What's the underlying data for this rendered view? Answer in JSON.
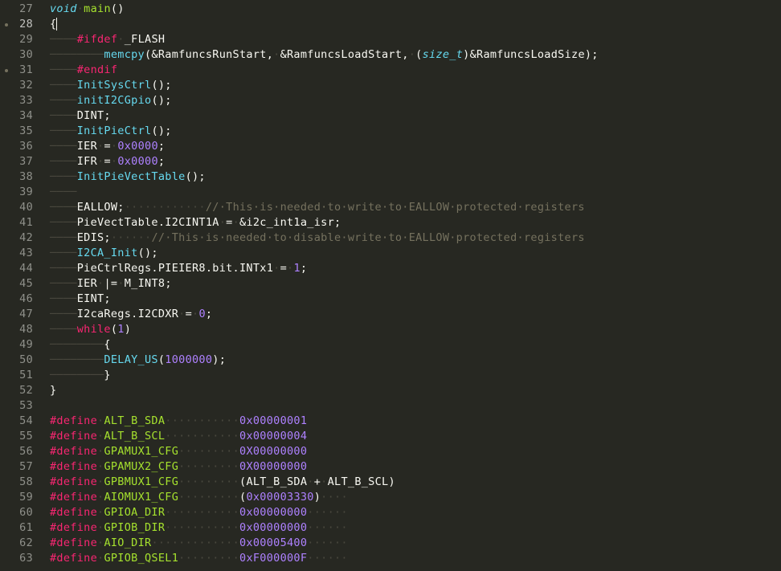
{
  "editor": {
    "theme": "monokai",
    "colors": {
      "background": "#272822",
      "text": "#f8f8f2",
      "keyword": "#f92672",
      "function": "#66d9ef",
      "number": "#ae81ff",
      "comment": "#75715e",
      "line_number": "#8f908a",
      "whitespace_marker": "#49483e"
    },
    "lines": [
      {
        "num": "27",
        "tokens": [
          {
            "t": "void",
            "c": "kwi"
          },
          {
            "t": "·",
            "c": "ws"
          },
          {
            "t": "main",
            "c": "fn"
          },
          {
            "t": "()",
            "c": "text"
          }
        ]
      },
      {
        "num": "28",
        "current": true,
        "marked": true,
        "tokens": [
          {
            "t": "{",
            "c": "text"
          },
          {
            "cursor": true
          }
        ]
      },
      {
        "num": "29",
        "tokens": [
          {
            "t": "────",
            "c": "guide"
          },
          {
            "t": "#ifdef",
            "c": "pre"
          },
          {
            "t": "·",
            "c": "ws"
          },
          {
            "t": "_FLASH",
            "c": "text"
          }
        ]
      },
      {
        "num": "30",
        "tokens": [
          {
            "t": "────────",
            "c": "guide"
          },
          {
            "t": "memcpy",
            "c": "fnb"
          },
          {
            "t": "(&RamfuncsRunStart,",
            "c": "text"
          },
          {
            "t": "·",
            "c": "ws"
          },
          {
            "t": "&RamfuncsLoadStart,",
            "c": "text"
          },
          {
            "t": "·",
            "c": "ws"
          },
          {
            "t": "(",
            "c": "text"
          },
          {
            "t": "size_t",
            "c": "typei"
          },
          {
            "t": ")&RamfuncsLoadSize);",
            "c": "text"
          }
        ]
      },
      {
        "num": "31",
        "marked": true,
        "tokens": [
          {
            "t": "────",
            "c": "guide"
          },
          {
            "t": "#endif",
            "c": "pre"
          }
        ]
      },
      {
        "num": "32",
        "tokens": [
          {
            "t": "────",
            "c": "guide"
          },
          {
            "t": "InitSysCtrl",
            "c": "fnb"
          },
          {
            "t": "();",
            "c": "text"
          }
        ]
      },
      {
        "num": "33",
        "tokens": [
          {
            "t": "────",
            "c": "guide"
          },
          {
            "t": "initI2CGpio",
            "c": "fnb"
          },
          {
            "t": "();",
            "c": "text"
          }
        ]
      },
      {
        "num": "34",
        "tokens": [
          {
            "t": "────",
            "c": "guide"
          },
          {
            "t": "DINT;",
            "c": "text"
          }
        ]
      },
      {
        "num": "35",
        "tokens": [
          {
            "t": "────",
            "c": "guide"
          },
          {
            "t": "InitPieCtrl",
            "c": "fnb"
          },
          {
            "t": "();",
            "c": "text"
          }
        ]
      },
      {
        "num": "36",
        "tokens": [
          {
            "t": "────",
            "c": "guide"
          },
          {
            "t": "IER",
            "c": "text"
          },
          {
            "t": "·",
            "c": "ws"
          },
          {
            "t": "=",
            "c": "text"
          },
          {
            "t": "·",
            "c": "ws"
          },
          {
            "t": "0x0000",
            "c": "num"
          },
          {
            "t": ";",
            "c": "text"
          }
        ]
      },
      {
        "num": "37",
        "tokens": [
          {
            "t": "────",
            "c": "guide"
          },
          {
            "t": "IFR",
            "c": "text"
          },
          {
            "t": "·",
            "c": "ws"
          },
          {
            "t": "=",
            "c": "text"
          },
          {
            "t": "·",
            "c": "ws"
          },
          {
            "t": "0x0000",
            "c": "num"
          },
          {
            "t": ";",
            "c": "text"
          }
        ]
      },
      {
        "num": "38",
        "tokens": [
          {
            "t": "────",
            "c": "guide"
          },
          {
            "t": "InitPieVectTable",
            "c": "fnb"
          },
          {
            "t": "();",
            "c": "text"
          }
        ]
      },
      {
        "num": "39",
        "tokens": [
          {
            "t": "────",
            "c": "guide"
          }
        ]
      },
      {
        "num": "40",
        "tokens": [
          {
            "t": "────",
            "c": "guide"
          },
          {
            "t": "EALLOW;",
            "c": "text"
          },
          {
            "t": "············",
            "c": "ws"
          },
          {
            "t": "//·This·is·needed·to·write·to·EALLOW·protected·registers",
            "c": "cmt"
          }
        ]
      },
      {
        "num": "41",
        "tokens": [
          {
            "t": "────",
            "c": "guide"
          },
          {
            "t": "PieVectTable.I2CINT1A",
            "c": "text"
          },
          {
            "t": "·",
            "c": "ws"
          },
          {
            "t": "=",
            "c": "text"
          },
          {
            "t": "·",
            "c": "ws"
          },
          {
            "t": "&i2c_int1a_isr;",
            "c": "text"
          }
        ]
      },
      {
        "num": "42",
        "tokens": [
          {
            "t": "────",
            "c": "guide"
          },
          {
            "t": "EDIS;",
            "c": "text"
          },
          {
            "t": "······",
            "c": "ws"
          },
          {
            "t": "//·This·is·needed·to·disable·write·to·EALLOW·protected·registers",
            "c": "cmt"
          }
        ]
      },
      {
        "num": "43",
        "tokens": [
          {
            "t": "────",
            "c": "guide"
          },
          {
            "t": "I2CA_Init",
            "c": "fnb"
          },
          {
            "t": "();",
            "c": "text"
          }
        ]
      },
      {
        "num": "44",
        "tokens": [
          {
            "t": "────",
            "c": "guide"
          },
          {
            "t": "PieCtrlRegs.PIEIER8.bit.INTx1",
            "c": "text"
          },
          {
            "t": "·",
            "c": "ws"
          },
          {
            "t": "=",
            "c": "text"
          },
          {
            "t": "·",
            "c": "ws"
          },
          {
            "t": "1",
            "c": "num"
          },
          {
            "t": ";",
            "c": "text"
          }
        ]
      },
      {
        "num": "45",
        "tokens": [
          {
            "t": "────",
            "c": "guide"
          },
          {
            "t": "IER",
            "c": "text"
          },
          {
            "t": "·",
            "c": "ws"
          },
          {
            "t": "|=",
            "c": "text"
          },
          {
            "t": "·",
            "c": "ws"
          },
          {
            "t": "M_INT8;",
            "c": "text"
          }
        ]
      },
      {
        "num": "46",
        "tokens": [
          {
            "t": "────",
            "c": "guide"
          },
          {
            "t": "EINT;",
            "c": "text"
          }
        ]
      },
      {
        "num": "47",
        "tokens": [
          {
            "t": "────",
            "c": "guide"
          },
          {
            "t": "I2caRegs.I2CDXR",
            "c": "text"
          },
          {
            "t": "·",
            "c": "ws"
          },
          {
            "t": "=",
            "c": "text"
          },
          {
            "t": "·",
            "c": "ws"
          },
          {
            "t": "0",
            "c": "num"
          },
          {
            "t": ";",
            "c": "text"
          }
        ]
      },
      {
        "num": "48",
        "tokens": [
          {
            "t": "────",
            "c": "guide"
          },
          {
            "t": "while",
            "c": "pre"
          },
          {
            "t": "(",
            "c": "text"
          },
          {
            "t": "1",
            "c": "num"
          },
          {
            "t": ")",
            "c": "text"
          }
        ]
      },
      {
        "num": "49",
        "tokens": [
          {
            "t": "────────",
            "c": "guide"
          },
          {
            "t": "{",
            "c": "text"
          }
        ]
      },
      {
        "num": "50",
        "tokens": [
          {
            "t": "────────",
            "c": "guide"
          },
          {
            "t": "DELAY_US",
            "c": "fnb"
          },
          {
            "t": "(",
            "c": "text"
          },
          {
            "t": "1000000",
            "c": "num"
          },
          {
            "t": ");",
            "c": "text"
          }
        ]
      },
      {
        "num": "51",
        "tokens": [
          {
            "t": "────────",
            "c": "guide"
          },
          {
            "t": "}",
            "c": "text"
          }
        ]
      },
      {
        "num": "52",
        "tokens": [
          {
            "t": "}",
            "c": "text"
          }
        ]
      },
      {
        "num": "53",
        "tokens": []
      },
      {
        "num": "54",
        "tokens": [
          {
            "t": "#define",
            "c": "pre"
          },
          {
            "t": "·",
            "c": "ws"
          },
          {
            "t": "ALT_B_SDA",
            "c": "macro"
          },
          {
            "t": "···········",
            "c": "ws"
          },
          {
            "t": "0x00000001",
            "c": "num"
          }
        ]
      },
      {
        "num": "55",
        "tokens": [
          {
            "t": "#define",
            "c": "pre"
          },
          {
            "t": "·",
            "c": "ws"
          },
          {
            "t": "ALT_B_SCL",
            "c": "macro"
          },
          {
            "t": "···········",
            "c": "ws"
          },
          {
            "t": "0x00000004",
            "c": "num"
          }
        ]
      },
      {
        "num": "56",
        "tokens": [
          {
            "t": "#define",
            "c": "pre"
          },
          {
            "t": "·",
            "c": "ws"
          },
          {
            "t": "GPAMUX1_CFG",
            "c": "macro"
          },
          {
            "t": "·········",
            "c": "ws"
          },
          {
            "t": "0X00000000",
            "c": "num"
          }
        ]
      },
      {
        "num": "57",
        "tokens": [
          {
            "t": "#define",
            "c": "pre"
          },
          {
            "t": "·",
            "c": "ws"
          },
          {
            "t": "GPAMUX2_CFG",
            "c": "macro"
          },
          {
            "t": "·········",
            "c": "ws"
          },
          {
            "t": "0X00000000",
            "c": "num"
          }
        ]
      },
      {
        "num": "58",
        "tokens": [
          {
            "t": "#define",
            "c": "pre"
          },
          {
            "t": "·",
            "c": "ws"
          },
          {
            "t": "GPBMUX1_CFG",
            "c": "macro"
          },
          {
            "t": "·········",
            "c": "ws"
          },
          {
            "t": "(ALT_B_SDA",
            "c": "text"
          },
          {
            "t": "·",
            "c": "ws"
          },
          {
            "t": "+",
            "c": "text"
          },
          {
            "t": "·",
            "c": "ws"
          },
          {
            "t": "ALT_B_SCL)",
            "c": "text"
          }
        ]
      },
      {
        "num": "59",
        "tokens": [
          {
            "t": "#define",
            "c": "pre"
          },
          {
            "t": "·",
            "c": "ws"
          },
          {
            "t": "AIOMUX1_CFG",
            "c": "macro"
          },
          {
            "t": "·········",
            "c": "ws"
          },
          {
            "t": "(",
            "c": "text"
          },
          {
            "t": "0x00003330",
            "c": "num"
          },
          {
            "t": ")",
            "c": "text"
          },
          {
            "t": "····",
            "c": "ws"
          }
        ]
      },
      {
        "num": "60",
        "tokens": [
          {
            "t": "#define",
            "c": "pre"
          },
          {
            "t": "·",
            "c": "ws"
          },
          {
            "t": "GPIOA_DIR",
            "c": "macro"
          },
          {
            "t": "···········",
            "c": "ws"
          },
          {
            "t": "0x00000000",
            "c": "num"
          },
          {
            "t": "······",
            "c": "ws"
          }
        ]
      },
      {
        "num": "61",
        "tokens": [
          {
            "t": "#define",
            "c": "pre"
          },
          {
            "t": "·",
            "c": "ws"
          },
          {
            "t": "GPIOB_DIR",
            "c": "macro"
          },
          {
            "t": "···········",
            "c": "ws"
          },
          {
            "t": "0x00000000",
            "c": "num"
          },
          {
            "t": "······",
            "c": "ws"
          }
        ]
      },
      {
        "num": "62",
        "tokens": [
          {
            "t": "#define",
            "c": "pre"
          },
          {
            "t": "·",
            "c": "ws"
          },
          {
            "t": "AIO_DIR",
            "c": "macro"
          },
          {
            "t": "·············",
            "c": "ws"
          },
          {
            "t": "0x00005400",
            "c": "num"
          },
          {
            "t": "······",
            "c": "ws"
          }
        ]
      },
      {
        "num": "63",
        "tokens": [
          {
            "t": "#define",
            "c": "pre"
          },
          {
            "t": "·",
            "c": "ws"
          },
          {
            "t": "GPIOB_QSEL1",
            "c": "macro"
          },
          {
            "t": "·········",
            "c": "ws"
          },
          {
            "t": "0xF000000F",
            "c": "num"
          },
          {
            "t": "······",
            "c": "ws"
          }
        ]
      }
    ]
  }
}
